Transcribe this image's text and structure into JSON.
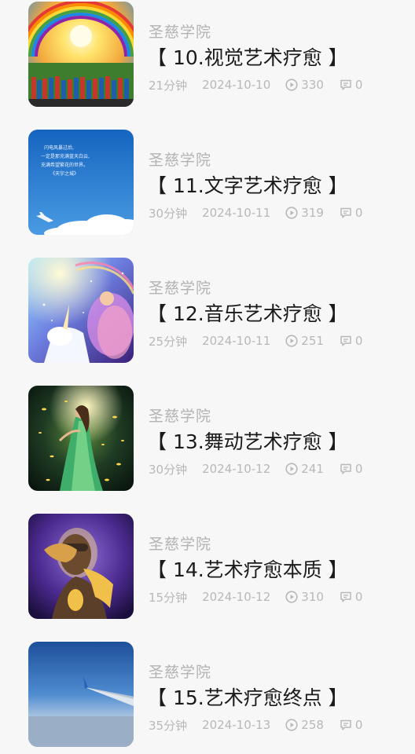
{
  "items": [
    {
      "source": "圣慈学院",
      "title": "【 10.视觉艺术疗愈 】",
      "duration": "21分钟",
      "date": "2024-10-10",
      "views": "330",
      "comments": "0",
      "image": "rainbow-sun-crowd"
    },
    {
      "source": "圣慈学院",
      "title": "【 11.文字艺术疗愈 】",
      "duration": "30分钟",
      "date": "2024-10-11",
      "views": "319",
      "comments": "0",
      "image": "blue-sky-poem-plane",
      "image_text": [
        "闪电风暴过后,",
        "一定是那充满蓝天白云,",
        "充满希望繁花的世界。",
        "《天宇之城》"
      ]
    },
    {
      "source": "圣慈学院",
      "title": "【 12.音乐艺术疗愈 】",
      "duration": "25分钟",
      "date": "2024-10-11",
      "views": "251",
      "comments": "0",
      "image": "unicorn-fairy-rainbow"
    },
    {
      "source": "圣慈学院",
      "title": "【 13.舞动艺术疗愈 】",
      "duration": "30分钟",
      "date": "2024-10-12",
      "views": "241",
      "comments": "0",
      "image": "dancing-woman-lights"
    },
    {
      "source": "圣慈学院",
      "title": "【 14.艺术疗愈本质 】",
      "duration": "15分钟",
      "date": "2024-10-12",
      "views": "310",
      "comments": "0",
      "image": "face-hands-glow"
    },
    {
      "source": "圣慈学院",
      "title": "【 15.艺术疗愈终点 】",
      "duration": "35分钟",
      "date": "2024-10-13",
      "views": "258",
      "comments": "0",
      "image": "airplane-wing-sky"
    }
  ],
  "icons": {
    "views": "play-circle-icon",
    "comments": "comment-bubble-icon"
  }
}
